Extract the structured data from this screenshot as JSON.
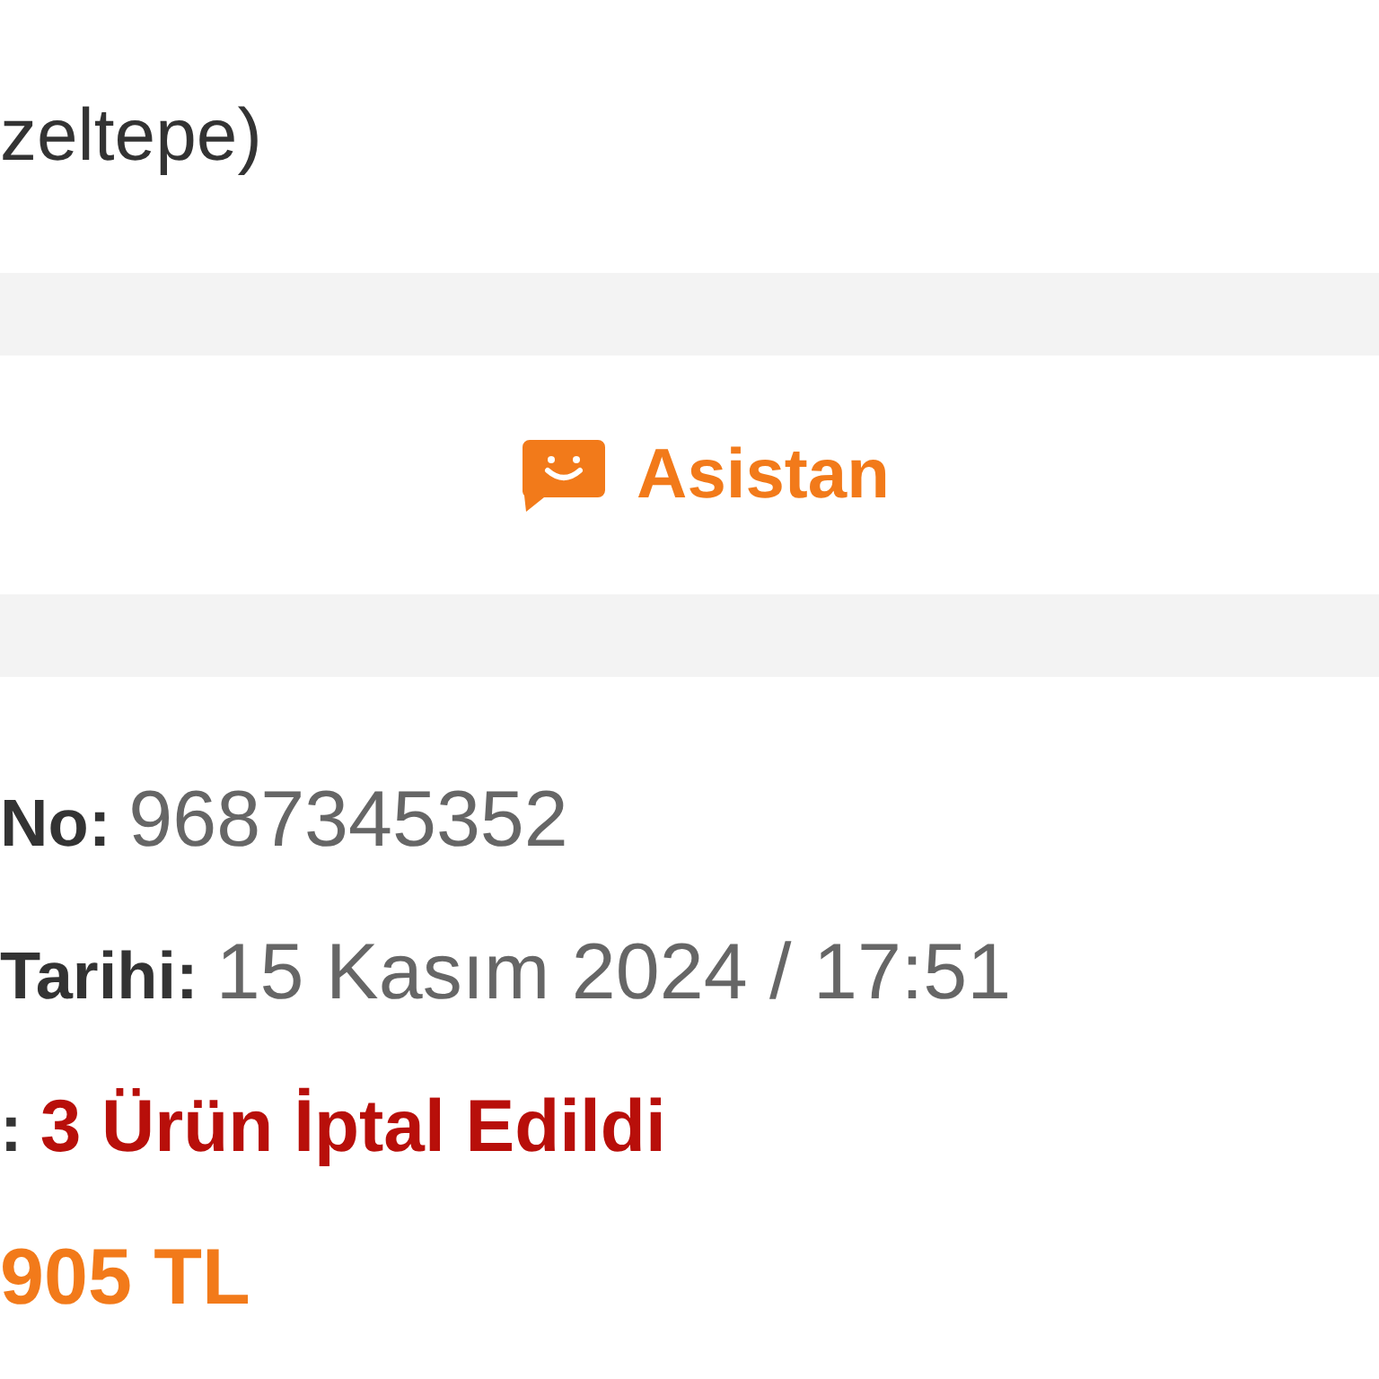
{
  "address": {
    "text": "zeltepe)"
  },
  "assistant_button": {
    "label": "Asistan"
  },
  "order_details": [
    {
      "kind": "plain",
      "label": "No:",
      "value": "9687345352"
    },
    {
      "kind": "plain",
      "label": "Tarihi:",
      "value": "15 Kasım 2024 / 17:51"
    },
    {
      "kind": "status",
      "label": ":",
      "value": "3 Ürün İptal Edildi"
    },
    {
      "kind": "price",
      "value": "905 TL"
    }
  ]
}
